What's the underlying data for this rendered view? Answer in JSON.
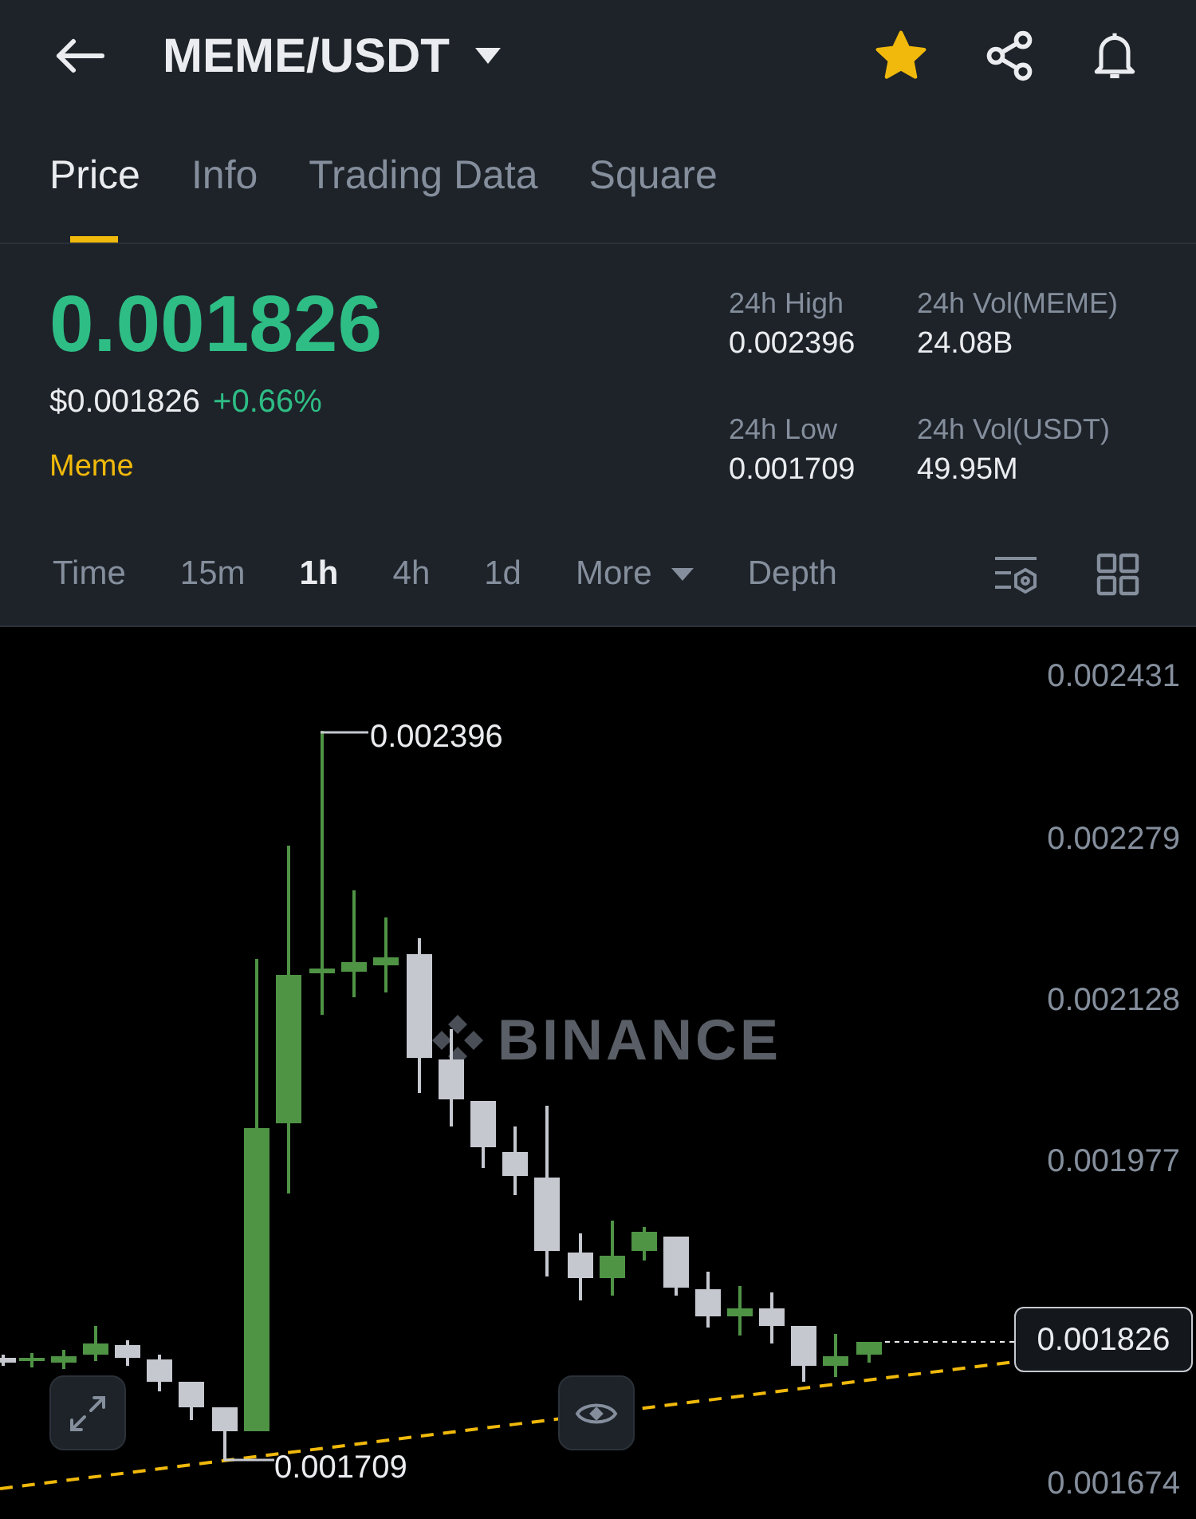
{
  "header": {
    "pair": "MEME/USDT",
    "favorite": true
  },
  "tabs": [
    {
      "label": "Price",
      "selected": true
    },
    {
      "label": "Info",
      "selected": false
    },
    {
      "label": "Trading Data",
      "selected": false
    },
    {
      "label": "Square",
      "selected": false
    }
  ],
  "price": {
    "last": "0.001826",
    "usd": "$0.001826",
    "change": "+0.66%",
    "tag": "Meme"
  },
  "stats": [
    {
      "label": "24h High",
      "value": "0.002396"
    },
    {
      "label": "24h Vol(MEME)",
      "value": "24.08B"
    },
    {
      "label": "24h Low",
      "value": "0.001709"
    },
    {
      "label": "24h Vol(USDT)",
      "value": "49.95M"
    }
  ],
  "intervals": [
    {
      "label": "Time",
      "selected": false,
      "kind": "option"
    },
    {
      "label": "15m",
      "selected": false,
      "kind": "option"
    },
    {
      "label": "1h",
      "selected": true,
      "kind": "option"
    },
    {
      "label": "4h",
      "selected": false,
      "kind": "option"
    },
    {
      "label": "1d",
      "selected": false,
      "kind": "option"
    },
    {
      "label": "More",
      "selected": false,
      "kind": "dropdown"
    },
    {
      "label": "Depth",
      "selected": false,
      "kind": "option"
    }
  ],
  "chart": {
    "y_labels": [
      "0.002431",
      "0.002279",
      "0.002128",
      "0.001977",
      "0.001674"
    ],
    "high_label": "0.002396",
    "low_label": "0.001709",
    "last_price": "0.001826",
    "watermark": "BINANCE"
  }
}
